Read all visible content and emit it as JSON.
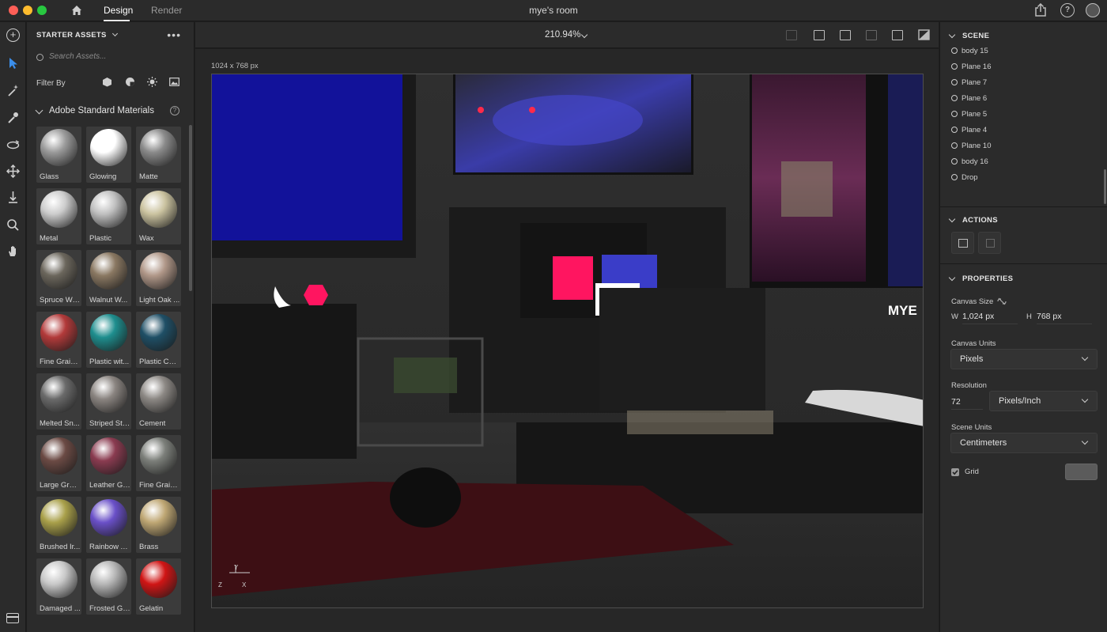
{
  "app": {
    "title": "mye's room",
    "tabs": [
      {
        "label": "Design",
        "active": true
      },
      {
        "label": "Render",
        "active": false
      }
    ],
    "icons": {
      "home": "home-icon",
      "share": "share-icon",
      "help": "help-icon",
      "user": "user-icon"
    }
  },
  "tools": [
    "add-icon",
    "select-icon",
    "magic-wand-icon",
    "eyedropper-icon",
    "orbit-icon",
    "pan-move-icon",
    "drop-to-ground-icon",
    "zoom-icon",
    "hand-icon"
  ],
  "assets": {
    "header": "STARTER ASSETS",
    "search_placeholder": "Search Assets...",
    "filter_label": "Filter By",
    "filter_icons": [
      "models-icon",
      "materials-icon",
      "lights-icon",
      "images-icon"
    ],
    "section_title": "Adobe Standard Materials",
    "materials": [
      {
        "label": "Glass",
        "color": "#9a9a9a"
      },
      {
        "label": "Glowing",
        "color": "#ffffff"
      },
      {
        "label": "Matte",
        "color": "#8a8a8a"
      },
      {
        "label": "Metal",
        "color": "#cccccc"
      },
      {
        "label": "Plastic",
        "color": "#c0c0c0"
      },
      {
        "label": "Wax",
        "color": "#cbc3a0"
      },
      {
        "label": "Spruce Wo...",
        "color": "#6b665c"
      },
      {
        "label": "Walnut W...",
        "color": "#8a7862"
      },
      {
        "label": "Light Oak ...",
        "color": "#b09788"
      },
      {
        "label": "Fine Grain...",
        "color": "#b23a3a"
      },
      {
        "label": "Plastic wit...",
        "color": "#1e8e8e"
      },
      {
        "label": "Plastic Can...",
        "color": "#1f4f66"
      },
      {
        "label": "Melted Sn...",
        "color": "#6a6a6a"
      },
      {
        "label": "Striped Sto...",
        "color": "#8a8480"
      },
      {
        "label": "Cement",
        "color": "#8c8884"
      },
      {
        "label": "Large Grai...",
        "color": "#6b4a44"
      },
      {
        "label": "Leather Gr...",
        "color": "#8a3b50"
      },
      {
        "label": "Fine Grain...",
        "color": "#7c7f7a"
      },
      {
        "label": "Brushed Ir...",
        "color": "#a9a04a"
      },
      {
        "label": "Rainbow A...",
        "color": "#6a50c8"
      },
      {
        "label": "Brass",
        "color": "#bfa774"
      },
      {
        "label": "Damaged ...",
        "color": "#c8c8c8"
      },
      {
        "label": "Frosted Gl...",
        "color": "#b6b6b6"
      },
      {
        "label": "Gelatin",
        "color": "#d01515"
      }
    ]
  },
  "canvas": {
    "zoom": "210.94%",
    "size_label": "1024 x 768 px",
    "toolbar_icons": [
      "frame-icon",
      "camera-fit-icon",
      "camera-bookmark-icon",
      "camera-add-icon",
      "camera-export-icon",
      "preview-icon"
    ]
  },
  "scene_panel": {
    "header": "SCENE",
    "items": [
      "body 15",
      "Plane 16",
      "Plane 7",
      "Plane 6",
      "Plane 5",
      "Plane 4",
      "Plane 10",
      "body 16",
      "Drop"
    ]
  },
  "actions": {
    "header": "ACTIONS",
    "icons": [
      "fit-to-canvas-icon",
      "remove-background-icon"
    ]
  },
  "properties": {
    "header": "PROPERTIES",
    "canvas_size_label": "Canvas Size",
    "w_label": "W",
    "w_value": "1,024 px",
    "h_label": "H",
    "h_value": "768 px",
    "canvas_units_label": "Canvas Units",
    "canvas_units_value": "Pixels",
    "resolution_label": "Resolution",
    "resolution_value": "72",
    "resolution_unit": "Pixels/Inch",
    "scene_units_label": "Scene Units",
    "scene_units_value": "Centimeters",
    "grid_label": "Grid",
    "grid_checked": true,
    "grid_color": "#5b5b5b"
  },
  "scene_text": {
    "wall_logo": "MYE",
    "axis_y": "Y",
    "axis_x": "X",
    "axis_z": "Z"
  }
}
